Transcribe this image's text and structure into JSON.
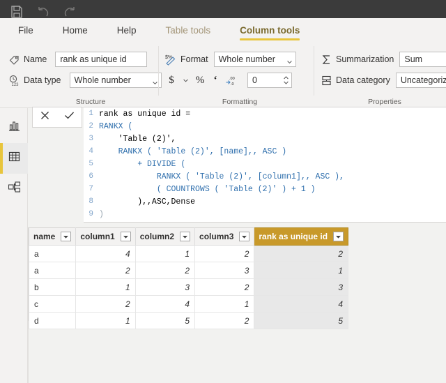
{
  "titlebar": {
    "icons": [
      {
        "name": "save-icon",
        "label": "Save"
      },
      {
        "name": "undo-icon",
        "label": "Undo"
      },
      {
        "name": "redo-icon",
        "label": "Redo"
      }
    ],
    "background": "#3b3b3b"
  },
  "ribbon_tabs": {
    "accent": "#e8c53c",
    "items": [
      {
        "label": "File",
        "active": false
      },
      {
        "label": "Home",
        "active": false
      },
      {
        "label": "Help",
        "active": false
      },
      {
        "label": "Table tools",
        "active": false
      },
      {
        "label": "Column tools",
        "active": true
      }
    ]
  },
  "ribbon": {
    "structure": {
      "group_label": "Structure",
      "name_label": "Name",
      "name_icon": "tag-icon",
      "name_value": "rank as unique id",
      "datatype_label": "Data type",
      "datatype_icon": "number-type-icon",
      "datatype_value": "Whole number"
    },
    "formatting": {
      "group_label": "Formatting",
      "format_label": "Format",
      "format_icon": "format-icon",
      "format_value": "Whole number",
      "currency_label": "$",
      "currency_icon": "currency-dropdown-icon",
      "percent_label": "%",
      "comma_label": "‘",
      "decimals_icon": "decrease-decimals-icon",
      "decimals_value": "0"
    },
    "properties": {
      "group_label": "Properties",
      "summarization_label": "Summarization",
      "summarization_icon": "sigma-icon",
      "summarization_value": "Sum",
      "datacategory_label": "Data category",
      "datacategory_icon": "data-category-icon",
      "datacategory_value": "Uncategorized"
    }
  },
  "leftnav": {
    "items": [
      {
        "name": "report-view",
        "icon": "bar-chart-icon",
        "label": "Report",
        "selected": false
      },
      {
        "name": "data-view",
        "icon": "table-grid-icon",
        "label": "Data",
        "selected": true
      },
      {
        "name": "model-view",
        "icon": "relationships-icon",
        "label": "Model",
        "selected": false
      }
    ],
    "selected_accent": "#e8c53c"
  },
  "formula_bar": {
    "cancel_label": "✕",
    "cancel_icon": "close-icon",
    "accept_label": "✓",
    "accept_icon": "checkmark-icon",
    "lines": [
      {
        "n": "1",
        "text": "rank as unique id ="
      },
      {
        "n": "2",
        "text": "RANKX ("
      },
      {
        "n": "3",
        "text": "    'Table (2)',"
      },
      {
        "n": "4",
        "text": "    RANKX ( 'Table (2)', [name],, ASC )"
      },
      {
        "n": "5",
        "text": "        + DIVIDE ("
      },
      {
        "n": "6",
        "text": "            RANKX ( 'Table (2)', [column1],, ASC ),"
      },
      {
        "n": "7",
        "text": "            ( COUNTROWS ( 'Table (2)' ) + 1 )"
      },
      {
        "n": "8",
        "text": "        ),,ASC,Dense"
      },
      {
        "n": "9",
        "text": ")"
      }
    ]
  },
  "grid": {
    "selected_header_color": "#c8992a",
    "filter_icon": "filter-dropdown-icon",
    "columns": [
      {
        "label": "name",
        "selected": false
      },
      {
        "label": "column1",
        "selected": false
      },
      {
        "label": "column2",
        "selected": false
      },
      {
        "label": "column3",
        "selected": false
      },
      {
        "label": "rank as unique id",
        "selected": true
      }
    ],
    "rows": [
      {
        "name": "a",
        "column1": "4",
        "column2": "1",
        "column3": "2",
        "rank": "2"
      },
      {
        "name": "a",
        "column1": "2",
        "column2": "2",
        "column3": "3",
        "rank": "1"
      },
      {
        "name": "b",
        "column1": "1",
        "column2": "3",
        "column3": "2",
        "rank": "3"
      },
      {
        "name": "c",
        "column1": "2",
        "column2": "4",
        "column3": "1",
        "rank": "4"
      },
      {
        "name": "d",
        "column1": "1",
        "column2": "5",
        "column3": "2",
        "rank": "5"
      }
    ]
  }
}
